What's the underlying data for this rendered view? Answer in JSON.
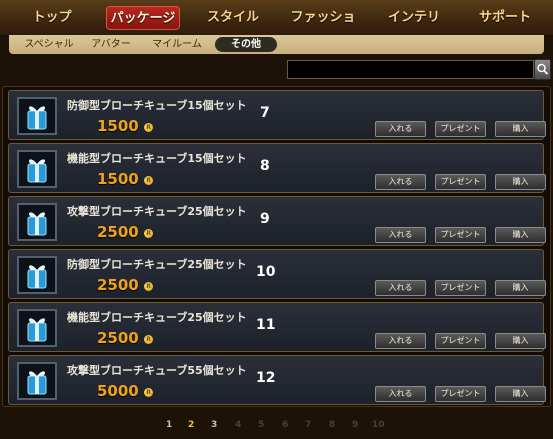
{
  "nav": {
    "tabs": [
      {
        "label": "トップ"
      },
      {
        "label": "パッケージ"
      },
      {
        "label": "スタイル"
      },
      {
        "label": "ファッション"
      },
      {
        "label": "インテリア"
      },
      {
        "label": "サポート"
      }
    ],
    "active_tab": "パッケージ"
  },
  "subnav": {
    "items": [
      {
        "label": "スペシャル"
      },
      {
        "label": "アバター"
      },
      {
        "label": "マイルーム"
      },
      {
        "label": "その他"
      }
    ],
    "active_item": "その他"
  },
  "search": {
    "value": "",
    "placeholder": "",
    "button_icon": "magnifier-icon"
  },
  "products": [
    {
      "name": "防御型ブローチキューブ15個セット",
      "price": "1500",
      "index": "7",
      "icon": "blue-gift-cube-icon"
    },
    {
      "name": "機能型ブローチキューブ15個セット",
      "price": "1500",
      "index": "8",
      "icon": "blue-gift-cube-icon"
    },
    {
      "name": "攻撃型ブローチキューブ25個セット",
      "price": "2500",
      "index": "9",
      "icon": "blue-gift-cube-icon"
    },
    {
      "name": "防御型ブローチキューブ25個セット",
      "price": "2500",
      "index": "10",
      "icon": "blue-gift-cube-icon"
    },
    {
      "name": "機能型ブローチキューブ25個セット",
      "price": "2500",
      "index": "11",
      "icon": "blue-gift-cube-icon"
    },
    {
      "name": "攻撃型ブローチキューブ55個セット",
      "price": "5000",
      "index": "12",
      "icon": "blue-gift-cube-icon"
    }
  ],
  "coin_glyph": "R",
  "buttons": {
    "cart": "入れる",
    "gift": "プレゼント",
    "buy": "購入"
  },
  "pagination": {
    "pages": [
      "1",
      "2",
      "3",
      "4",
      "5",
      "6",
      "7",
      "8",
      "9",
      "10"
    ],
    "current": "2"
  },
  "colors": {
    "price": "#f0a21a",
    "active_tab": "#b5281d",
    "current_page": "#f0c13a"
  }
}
